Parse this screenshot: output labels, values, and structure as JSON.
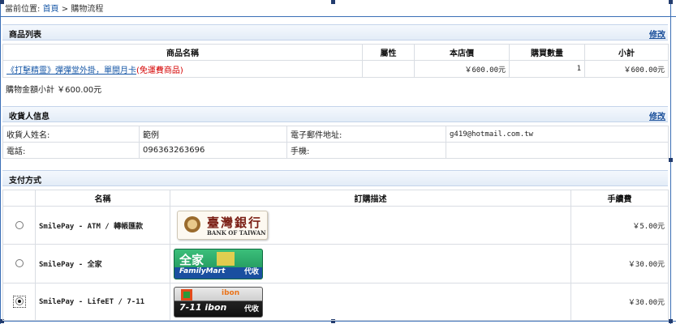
{
  "breadcrumb": {
    "prefix": "當前位置:",
    "home": "首頁",
    "separator": ">",
    "current": "購物流程"
  },
  "product_section": {
    "title": "商品列表",
    "edit_label": "修改",
    "columns": [
      "商品名稱",
      "屬性",
      "本店價",
      "購買數量",
      "小計"
    ],
    "rows": [
      {
        "name": "《打擊精靈》彈彈堂外掛，單開月卡",
        "note": "(免運費商品)",
        "attr": "",
        "price": "￥600.00元",
        "qty": "1",
        "subtotal": "￥600.00元"
      }
    ],
    "total": "購物金額小計 ￥600.00元"
  },
  "receiver_section": {
    "title": "收貨人信息",
    "edit_label": "修改",
    "name_label": "收貨人姓名:",
    "name_value": "範例",
    "email_label": "電子郵件地址:",
    "email_value": "g419@hotmail.com.tw",
    "phone_label": "電話:",
    "phone_value": "096363263696",
    "mobile_label": "手機:",
    "mobile_value": ""
  },
  "payment_section": {
    "title": "支付方式",
    "columns": [
      "名稱",
      "訂購描述",
      "手續費"
    ],
    "methods": [
      {
        "name": "SmilePay - ATM / 轉帳匯款",
        "fee": "￥5.00元",
        "selected": false,
        "logo": "bank-of-taiwan",
        "logo_zh": "臺灣銀行",
        "logo_en": "BANK OF TAIWAN"
      },
      {
        "name": "SmilePay - 全家",
        "fee": "￥30.00元",
        "selected": false,
        "logo": "familymart",
        "logo_zh": "全家",
        "logo_en": "FamilyMart",
        "logo_tag": "代收"
      },
      {
        "name": "SmilePay - LifeET / 7-11",
        "fee": "￥30.00元",
        "selected": true,
        "logo": "seven-eleven-ibon",
        "logo_main": "7-11 ibon",
        "logo_ibon": "ibon",
        "logo_tag": "代收"
      }
    ]
  },
  "colors": {
    "accent": "#1a5aa8",
    "section_bg": "#e3ecf7",
    "free_ship": "#d40000",
    "frame": "#3b6fb6"
  }
}
